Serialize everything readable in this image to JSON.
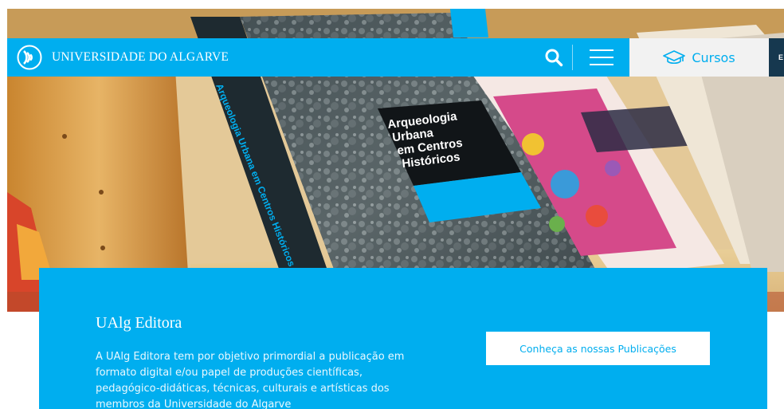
{
  "navbar": {
    "brand": "UNIVERSIDADE DO ALGARVE",
    "cursos_label": "Cursos",
    "dark_tab_label": "E"
  },
  "hero": {
    "book_title": [
      "Arqueologia",
      "Urbana",
      "em Centros",
      "Históricos"
    ],
    "book_spine": "Arqueologia Urbana em Centros Históricos"
  },
  "card": {
    "title": "UAlg Editora",
    "text": "A UAlg Editora tem por objetivo primordial a publicação em formato digital e/ou papel de produções científicas, pedagógico-didáticas, técnicas, culturais e artísticas dos membros da Universidade do Algarve",
    "cta_label": "Conheça as nossas Publicações"
  },
  "colors": {
    "accent": "#00aeef",
    "dark_tab": "#16384f",
    "cursos_bg": "#f2f2f2"
  },
  "icons": {
    "logo": "ualg-logo-icon",
    "search": "search-icon",
    "menu": "hamburger-menu-icon",
    "cursos": "graduation-cap-icon"
  }
}
